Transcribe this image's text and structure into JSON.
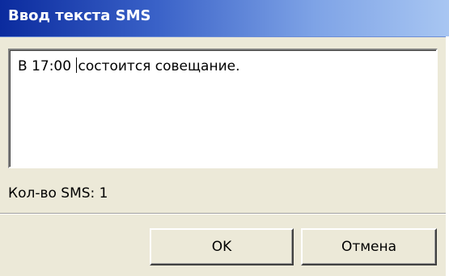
{
  "window": {
    "title": "Ввод текста SMS"
  },
  "message": {
    "text_before_caret": "В 17:00 ",
    "text_after_caret": "состоится совещание."
  },
  "status": {
    "sms_count": "Кол-во SMS: 1"
  },
  "buttons": {
    "ok_label": "OK",
    "cancel_label": "Отмена"
  },
  "colors": {
    "title_gradient_start": "#0b2b9e",
    "title_gradient_end": "#a8c6f2",
    "dialog_background": "#ece9d8"
  }
}
